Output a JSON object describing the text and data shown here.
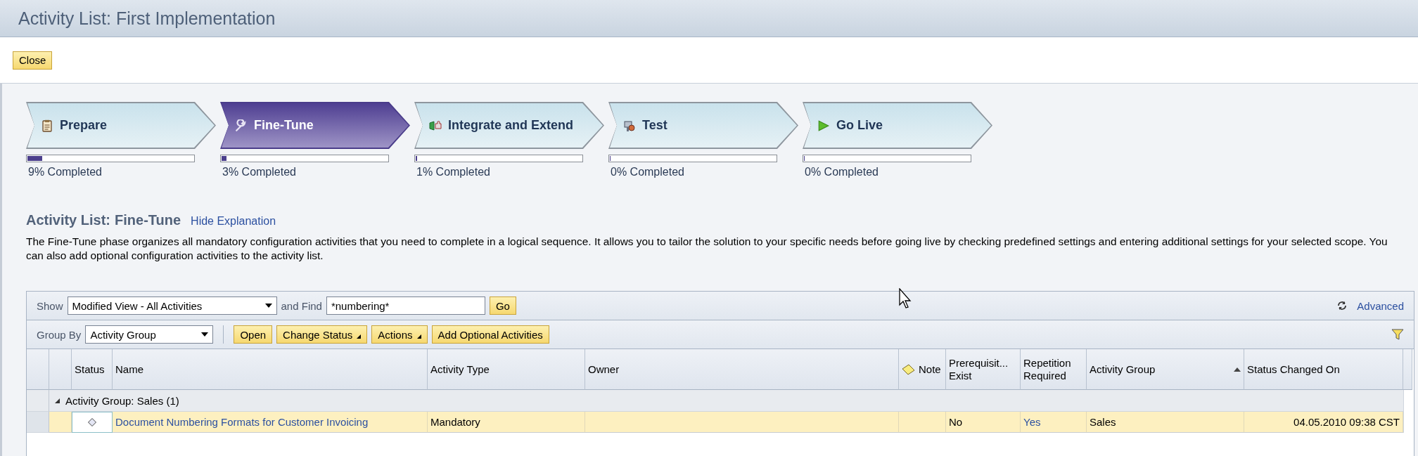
{
  "window": {
    "title": "Activity List: First Implementation"
  },
  "close_button": "Close",
  "phases": [
    {
      "label": "Prepare",
      "selected": false,
      "level": 0.09,
      "progress_text": "9% Completed"
    },
    {
      "label": "Fine-Tune",
      "selected": true,
      "level": 0.03,
      "progress_text": "3% Completed"
    },
    {
      "label": "Integrate and Extend",
      "selected": false,
      "level": 0.01,
      "progress_text": "1% Completed"
    },
    {
      "label": "Test",
      "selected": false,
      "level": 0.0,
      "progress_text": "0% Completed"
    },
    {
      "label": "Go Live",
      "selected": false,
      "level": 0.0,
      "progress_text": "0% Completed"
    }
  ],
  "activity_list": {
    "heading_label": "Activity List:",
    "heading_phase": "Fine-Tune",
    "hide_link": "Hide Explanation",
    "explanation": "The Fine-Tune phase organizes all mandatory configuration activities that you need to complete in a logical sequence. It allows you to tailor the solution to your specific needs before going live by checking predefined settings and entering additional settings for your selected scope. You can also add optional configuration activities to the activity list."
  },
  "toolbar": {
    "show_label": "Show",
    "show_value": "Modified View - All Activities",
    "find_label": "and Find",
    "find_value": "*numbering*",
    "go_button": "Go",
    "advanced_link": "Advanced",
    "group_by_label": "Group By",
    "group_by_value": "Activity Group",
    "buttons": [
      {
        "label": "Open",
        "menu": false
      },
      {
        "label": "Change Status",
        "menu": true
      },
      {
        "label": "Actions",
        "menu": true
      },
      {
        "label": "Add Optional Activities",
        "menu": false
      }
    ]
  },
  "table": {
    "columns": [
      {
        "label": "Status",
        "kind": "text",
        "sorted": false
      },
      {
        "label": "Name",
        "kind": "text",
        "sorted": false
      },
      {
        "label": "Activity Type",
        "kind": "text",
        "sorted": false
      },
      {
        "label": "Owner",
        "kind": "text",
        "sorted": false
      },
      {
        "label": "Note",
        "kind": "note",
        "sorted": false
      },
      {
        "label": "Prerequisit... Exist",
        "kind": "text",
        "sorted": false
      },
      {
        "label": "Repetition Required",
        "kind": "text",
        "sorted": false
      },
      {
        "label": "Activity Group",
        "kind": "text",
        "sorted": true
      },
      {
        "label": "Status Changed On",
        "kind": "text",
        "sorted": false
      }
    ],
    "group_row": {
      "label": "Activity Group: Sales (1)",
      "expanded": true
    },
    "rows": [
      {
        "selected": true,
        "name": "Document Numbering Formats for Customer Invoicing",
        "activity_type": "Mandatory",
        "prerequisites_exist": "No",
        "repetition_required": "Yes",
        "activity_group": "Sales",
        "status_changed_on": "04.05.2010 09:38 CST"
      }
    ]
  }
}
